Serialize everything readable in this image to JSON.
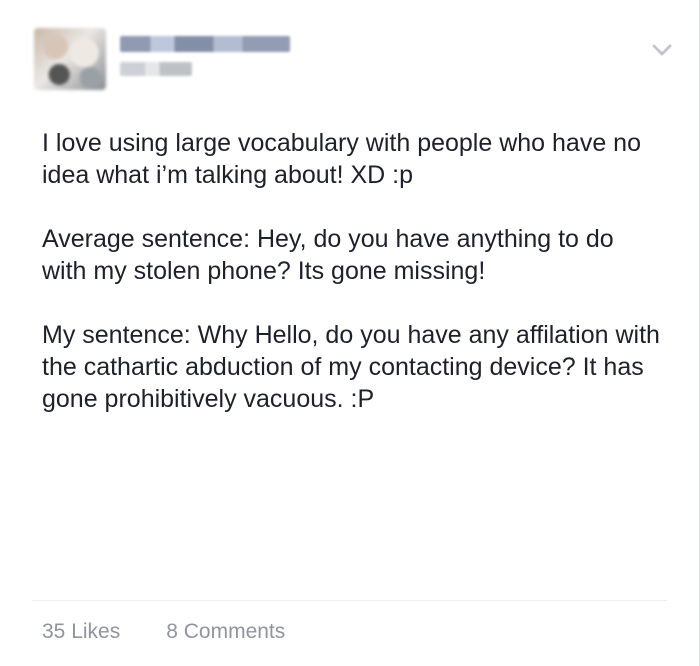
{
  "post": {
    "paragraphs": [
      "I love using large vocabulary with people who have no idea what i’m talking about! XD :p",
      "Average sentence: Hey, do you have anything to do with my stolen phone? Its gone missing!",
      "My sentence: Why Hello, do you have any affilation with the cathartic abduction of my contacting device? It has gone prohibitively vacuous. :P"
    ],
    "likes_label": "35 Likes",
    "comments_label": "8 Comments"
  },
  "icons": {
    "options": "chevron-down-icon"
  }
}
